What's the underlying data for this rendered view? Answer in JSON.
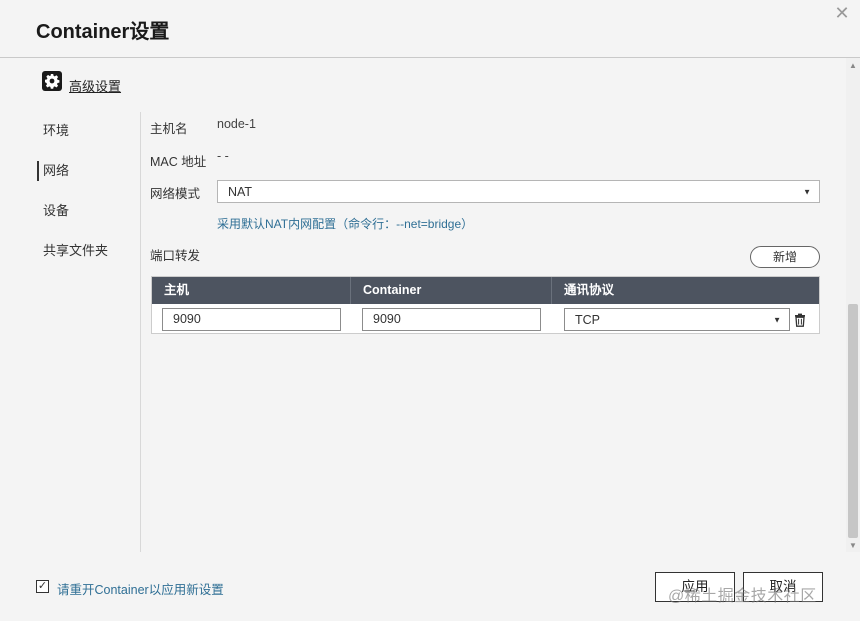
{
  "window": {
    "title": "Container设置",
    "close": "✕"
  },
  "advanced": {
    "label": "高级设置",
    "icon": "gear-icon"
  },
  "sidebar": {
    "items": [
      {
        "label": "环境",
        "active": false
      },
      {
        "label": "网络",
        "active": true
      },
      {
        "label": "设备",
        "active": false
      },
      {
        "label": "共享文件夹",
        "active": false
      }
    ]
  },
  "network": {
    "hostname_label": "主机名",
    "hostname_value": "node-1",
    "mac_label": "MAC 地址",
    "mac_value": "- -",
    "mode_label": "网络模式",
    "mode_value": "NAT",
    "mode_hint": "采用默认NAT内网配置（命令行：--net=bridge）",
    "port_forward_label": "端口转发",
    "add_button": "新增"
  },
  "port_table": {
    "headers": [
      "主机",
      "Container",
      "通讯协议"
    ],
    "rows": [
      {
        "host": "9090",
        "container": "9090",
        "protocol": "TCP"
      }
    ]
  },
  "footer": {
    "restart_checked": true,
    "check_mark": "✓",
    "restart_text": "请重开Container以应用新设置",
    "apply_button": "应用",
    "cancel_button": "取消"
  },
  "watermark": "@稀土掘金技术社区"
}
